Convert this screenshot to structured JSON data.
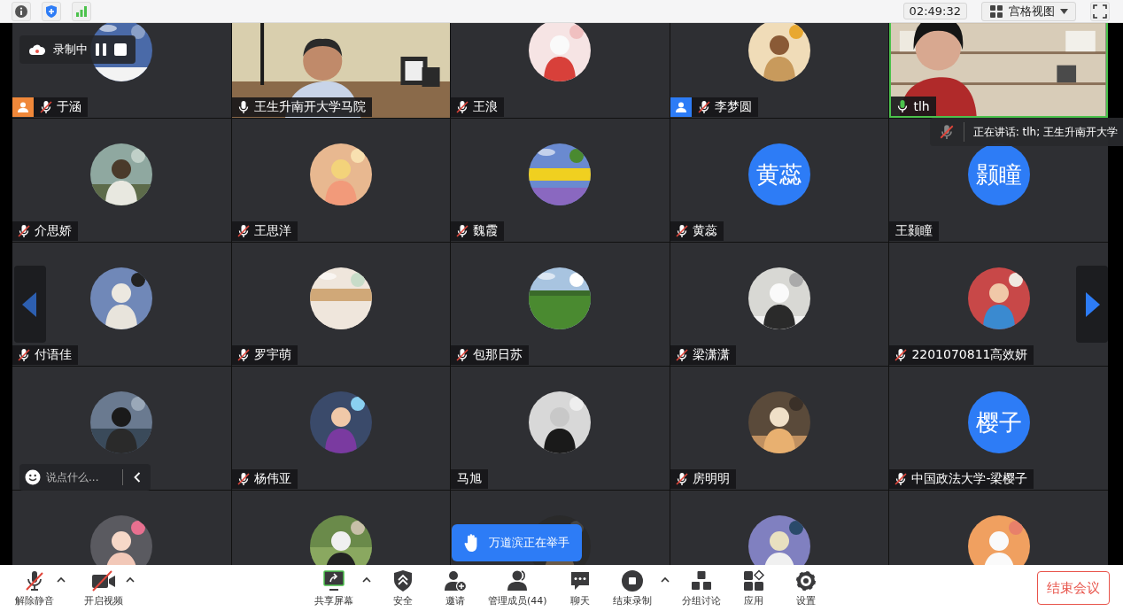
{
  "top_bar": {
    "timer": "02:49:32",
    "view_button": "宫格视图"
  },
  "tiles": [
    {
      "name": "于涵",
      "mic_icon": true,
      "muted": true,
      "speaking": false,
      "color": "#f0883a"
    },
    {
      "name": "王生升南开大学马院",
      "mic_icon": true,
      "muted": false,
      "speaking": false,
      "avatar": {
        "kind": "video"
      }
    },
    {
      "name": "王浪",
      "mic_icon": true,
      "muted": true,
      "speaking": false
    },
    {
      "name": "李梦圆",
      "mic_icon": true,
      "muted": true,
      "speaking": false,
      "color": "#2d7cf6"
    },
    {
      "name": "tlh",
      "mic_icon": true,
      "muted": false,
      "speaking": true,
      "avatar": {
        "kind": "video"
      }
    },
    {
      "name": "介思娇",
      "mic_icon": true,
      "muted": true,
      "speaking": false
    },
    {
      "name": "王思洋",
      "mic_icon": true,
      "muted": true,
      "speaking": false
    },
    {
      "name": "魏霞",
      "mic_icon": true,
      "muted": true,
      "speaking": false
    },
    {
      "name": "黄蕊",
      "mic_icon": true,
      "muted": true,
      "speaking": false,
      "avatar": {
        "kind": "initials",
        "text": "黄蕊"
      }
    },
    {
      "name": "王颢瞳",
      "mic_icon": false,
      "speaking": false,
      "avatar": {
        "kind": "initials",
        "text": "颢瞳"
      }
    },
    {
      "name": "付语佳",
      "mic_icon": true,
      "muted": true,
      "speaking": false
    },
    {
      "name": "罗宇萌",
      "mic_icon": true,
      "muted": true,
      "speaking": false
    },
    {
      "name": "包那日苏",
      "mic_icon": true,
      "muted": true,
      "speaking": false
    },
    {
      "name": "梁潇潇",
      "mic_icon": true,
      "muted": true,
      "speaking": false
    },
    {
      "name": "2201070811高效妍",
      "mic_icon": true,
      "muted": true,
      "speaking": false
    },
    {
      "speaking": false
    },
    {
      "name": "杨伟亚",
      "mic_icon": true,
      "muted": true,
      "speaking": false
    },
    {
      "name": "马旭",
      "mic_icon": false,
      "speaking": false
    },
    {
      "name": "房明明",
      "mic_icon": true,
      "muted": true,
      "speaking": false
    },
    {
      "name": "中国政法大学-梁樱子",
      "mic_icon": true,
      "muted": true,
      "speaking": false,
      "avatar": {
        "kind": "initials",
        "text": "樱子"
      }
    },
    {
      "speaking": false
    },
    {
      "speaking": false
    },
    {
      "speaking": false
    },
    {
      "speaking": false
    },
    {
      "speaking": false
    }
  ],
  "recording": {
    "label": "录制中"
  },
  "speaking_notice": {
    "text": "正在讲话: tlh; 王生升南开大学"
  },
  "chat_input": {
    "placeholder": "说点什么..."
  },
  "raised_hand": {
    "text": "万道滨正在举手"
  },
  "toolbar": {
    "left": [
      {
        "label": "解除静音",
        "menu": true
      },
      {
        "label": "开启视频",
        "menu": true
      }
    ],
    "center": [
      {
        "label": "共享屏幕",
        "menu": true
      },
      {
        "label": "安全",
        "menu": false
      },
      {
        "label": "邀请",
        "menu": false
      },
      {
        "label": "管理成员(44)",
        "menu": false
      },
      {
        "label": "聊天",
        "menu": false
      },
      {
        "label": "结束录制",
        "menu": true
      },
      {
        "label": "分组讨论",
        "menu": false
      },
      {
        "label": "应用",
        "menu": false
      },
      {
        "label": "设置",
        "menu": false
      }
    ],
    "end_button": "结束会议"
  }
}
